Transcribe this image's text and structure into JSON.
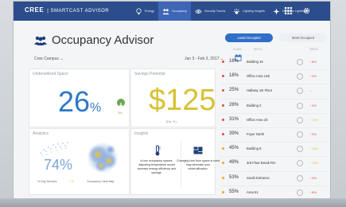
{
  "app": {
    "brand": "CREE",
    "brand_sub": "| SMARTCAST ADVISOR",
    "accent": "#2b4d8b"
  },
  "nav": {
    "items": [
      {
        "label": "Energy",
        "icon": "bulb-icon"
      },
      {
        "label": "Occupancy",
        "icon": "people-icon",
        "active": true
      },
      {
        "label": "Security Trends",
        "icon": "shield-icon"
      },
      {
        "label": "Lighting Insights",
        "icon": "lightbulb-icon"
      },
      {
        "label": "Dynamic Lighting",
        "icon": "sparkle-icon"
      }
    ],
    "tools": [
      "grid-icon",
      "gear-icon"
    ]
  },
  "page": {
    "title": "Occupancy Advisor",
    "campus": "Cree Campus",
    "date_range": "Jan 3 - Feb 3, 2017"
  },
  "underutilized": {
    "title": "Underutilized Space",
    "value": "26",
    "unit": "%",
    "change": "3%"
  },
  "savings": {
    "title": "Savings Potential",
    "value": "$125",
    "note": "(Est. Yr.)"
  },
  "analytics": {
    "title": "Analytics",
    "value": "74%",
    "labels": [
      "% Day Devices",
      "↑ %",
      "Occupancy Heat Map"
    ]
  },
  "insights": {
    "title": "Insights",
    "cards": [
      {
        "icon": "thermometer-icon",
        "text": "In low occupancy spaces, adjusting temperature would increase energy efficiency and savings."
      },
      {
        "icon": "floorplan-icon",
        "text": "Changing how floor space is used may decrease your underutilization."
      }
    ]
  },
  "tabs": {
    "least": "Least Occupied",
    "most": "Most Occupied"
  },
  "table": {
    "headers": [
      "CLASS",
      "SPACE",
      "TREND"
    ],
    "rows": [
      {
        "pct": "16%",
        "name": "Building 15",
        "trend": "↑ 8%",
        "color": "#e24b3b"
      },
      {
        "pct": "18%",
        "name": "Office Area 14E",
        "trend": "↑ 3%",
        "color": "#e24b3b"
      },
      {
        "pct": "25%",
        "name": "Hallway 1st Floor",
        "trend": "—",
        "color": "#e24b3b"
      },
      {
        "pct": "28%",
        "name": "Building 2",
        "trend": "↑ 4%",
        "color": "#e24b3b"
      },
      {
        "pct": "31%",
        "name": "Office Area 16",
        "trend": "↑ 12%",
        "color": "#e24b3b"
      },
      {
        "pct": "39%",
        "name": "Foyer North",
        "trend": "↑ 3%",
        "color": "#e24b3b"
      },
      {
        "pct": "45%",
        "name": "Building 8",
        "trend": "↑ 15%",
        "color": "#f0a72e"
      },
      {
        "pct": "49%",
        "name": "3rd Floor Break Rm",
        "trend": "↑ 12%",
        "color": "#f0a72e"
      },
      {
        "pct": "53%",
        "name": "South Entrance",
        "trend": "↑ 3%",
        "color": "#f0a72e"
      },
      {
        "pct": "55%",
        "name": "Area 51",
        "trend": "↑ 8%",
        "color": "#f0a72e"
      }
    ]
  }
}
